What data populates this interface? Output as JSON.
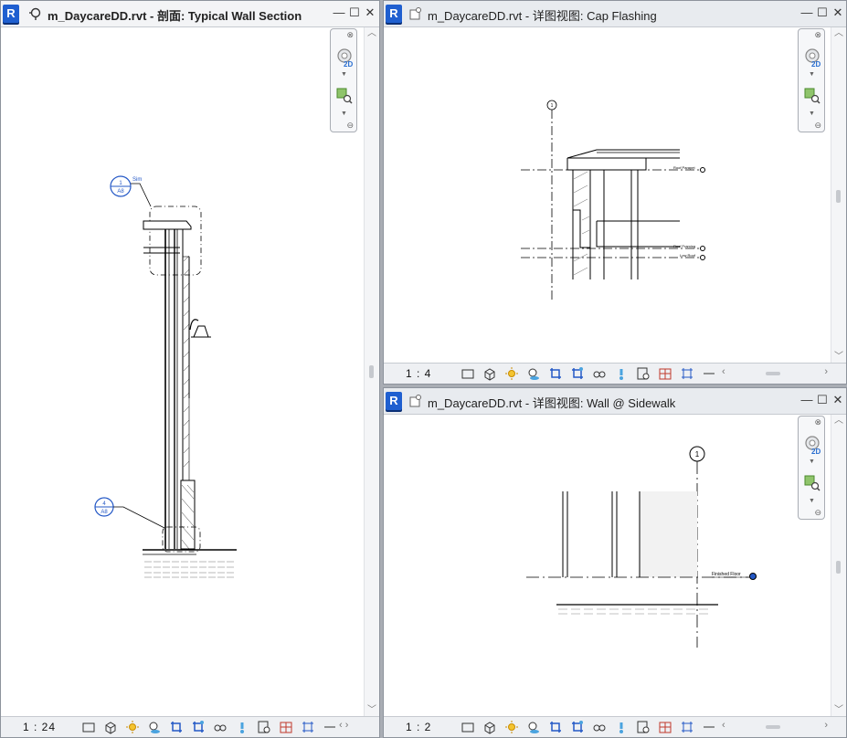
{
  "views": {
    "left": {
      "title": "m_DaycareDD.rvt - 剖面: Typical Wall Section",
      "scale": "1 : 24",
      "callout_top": {
        "number": "1",
        "sheet": "A8",
        "label": "Sim"
      },
      "callout_bottom": {
        "number": "4",
        "sheet": "A8"
      }
    },
    "top_right": {
      "title": "m_DaycareDD.rvt - 详图视图: Cap Flashing",
      "scale": "1 : 4",
      "grid_label": "1",
      "level_labels": [
        "Roof Parapet",
        "Roof Framing",
        "Low Roof"
      ]
    },
    "bottom_right": {
      "title": "m_DaycareDD.rvt - 详图视图: Wall @ Sidewalk",
      "scale": "1 : 2",
      "grid_label": "1",
      "level_label": "Finished Floor"
    }
  },
  "window_buttons": {
    "minimize": "—",
    "maximize": "☐",
    "close": "✕"
  },
  "logo_letter": "R",
  "navbar": {
    "two_d_tag": "2D"
  },
  "status_icons": [
    "detail-level-icon",
    "visual-style-icon",
    "sun-path-icon",
    "shadows-icon",
    "crop-region-icon",
    "show-crop-icon",
    "temporary-hide-icon",
    "reveal-hidden-icon",
    "temporary-properties-icon",
    "analytical-model-icon",
    "highlight-displacement-icon",
    "constraints-icon"
  ]
}
